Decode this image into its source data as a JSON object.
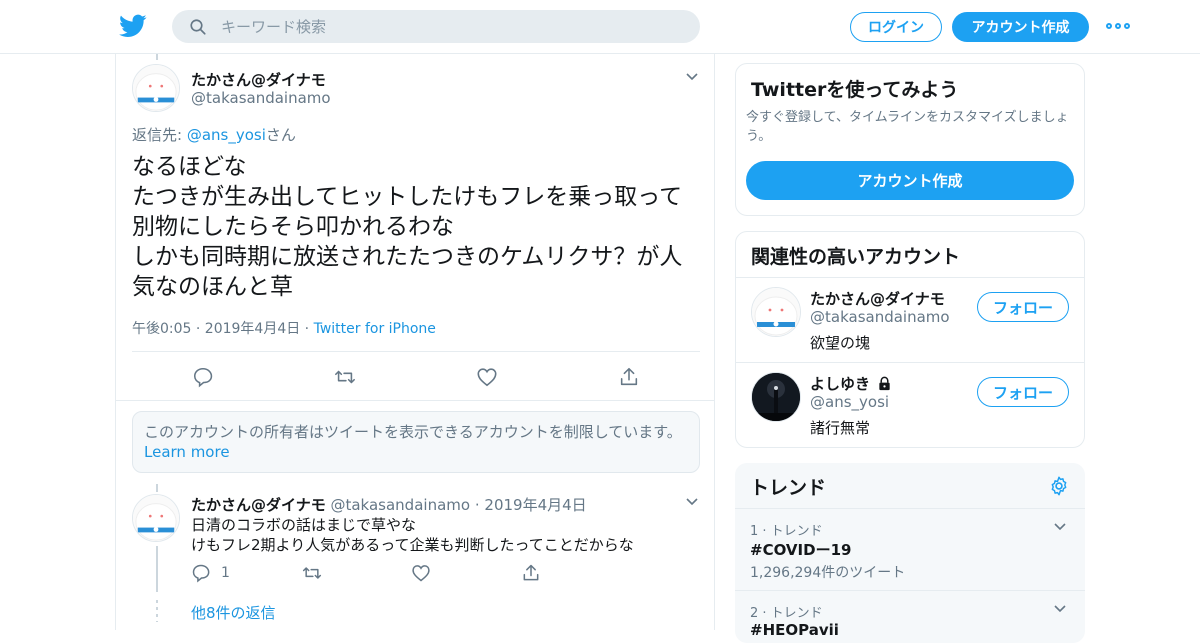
{
  "nav": {
    "search_placeholder": "キーワード検索",
    "login_label": "ログイン",
    "signup_label": "アカウント作成",
    "logo_icon": "twitter-bird-icon",
    "more_icon": "more-dots-icon"
  },
  "tweet": {
    "name": "たかさん@ダイナモ",
    "handle": "@takasandainamo",
    "reply_prefix": "返信先: ",
    "reply_to": "@ans_yosi",
    "reply_suffix": "さん",
    "text": "なるほどな\nたつきが生み出してヒットしたけもフレを乗っ取って別物にしたらそら叩かれるわな\nしかも同時期に放送されたたつきのケムリクサ？が人気なのほんと草",
    "time": "午後0:05 · 2019年4月4日",
    "separator": " · ",
    "source": "Twitter for iPhone"
  },
  "restricted_notice": {
    "text": "このアカウントの所有者はツイートを表示できるアカウントを制限しています。",
    "link": "Learn more"
  },
  "reply": {
    "name": "たかさん@ダイナモ",
    "handle": "@takasandainamo",
    "sep": "·",
    "date": "2019年4月4日",
    "text": "日清のコラボの話はまじで草やな\nけもフレ2期より人気があるって企業も判断したってことだからな",
    "reply_count": "1"
  },
  "more_replies": "他8件の返信",
  "signup_card": {
    "title": "Twitterを使ってみよう",
    "desc": "今すぐ登録して、タイムラインをカスタマイズしましょう。",
    "button": "アカウント作成"
  },
  "related": {
    "title": "関連性の高いアカウント",
    "follow_label": "フォロー",
    "accounts": [
      {
        "name": "たかさん@ダイナモ",
        "handle": "@takasandainamo",
        "bio": "欲望の塊"
      },
      {
        "name": "よしゆき",
        "handle": "@ans_yosi",
        "bio": "諸行無常"
      }
    ]
  },
  "trends": {
    "title": "トレンド",
    "items": [
      {
        "meta": "1 · トレンド",
        "tag": "#COVIDー19",
        "count": "1,296,294件のツイート"
      },
      {
        "meta": "2 · トレンド",
        "tag": "#HEOPavii",
        "count": ""
      }
    ]
  },
  "colors": {
    "accent": "#1da1f2",
    "link": "#1b95e0",
    "muted": "#657786",
    "border": "#e6ecf0",
    "panel": "#f5f8fa"
  }
}
